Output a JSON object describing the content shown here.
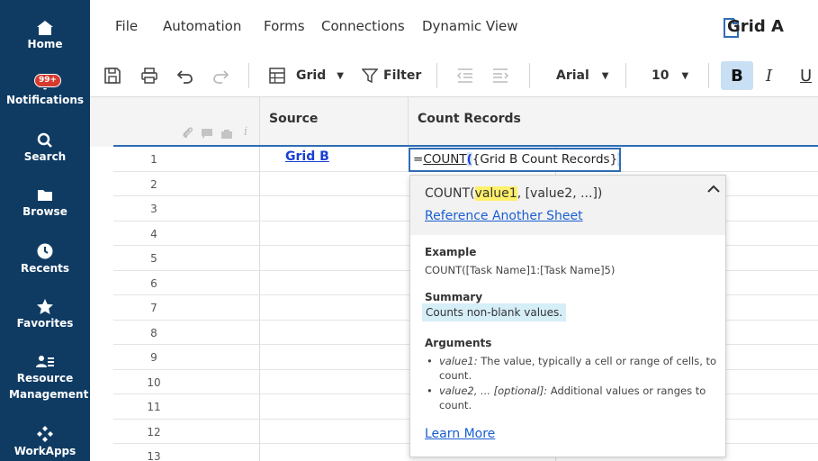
{
  "nav": {
    "items": [
      {
        "label": "Home",
        "icon": "home-icon"
      },
      {
        "label": "Notifications",
        "icon": "bell-icon",
        "badge": "99+"
      },
      {
        "label": "Search",
        "icon": "search-icon"
      },
      {
        "label": "Browse",
        "icon": "folder-icon"
      },
      {
        "label": "Recents",
        "icon": "clock-icon"
      },
      {
        "label": "Favorites",
        "icon": "star-icon"
      },
      {
        "label": "Resource Management",
        "icon": "people-icon"
      },
      {
        "label": "WorkApps",
        "icon": "apps-icon"
      }
    ]
  },
  "menu": {
    "items": [
      "File",
      "Automation",
      "Forms",
      "Connections",
      "Dynamic View"
    ],
    "title": "Grid A"
  },
  "toolbar": {
    "view_label": "Grid",
    "filter_label": "Filter",
    "font_family": "Arial",
    "font_size": "10",
    "bold": "B",
    "italic": "I",
    "underline": "U"
  },
  "grid": {
    "columns": [
      "Source",
      "Count Records"
    ],
    "row_numbers": [
      "1",
      "2",
      "3",
      "4",
      "5",
      "6",
      "7",
      "8",
      "9",
      "10",
      "11",
      "12",
      "13"
    ],
    "source_cell": "Grid B",
    "formula": {
      "prefix": "=",
      "fn": "COUNT",
      "paren": "(",
      "arg": "{Grid B Count Records}",
      "cursor": ")"
    }
  },
  "popup": {
    "sig_fn": "COUNT(",
    "sig_arg1": "value1",
    "sig_rest": ", [value2, ...])",
    "reference_link": "Reference Another Sheet",
    "example_title": "Example",
    "example_text": "COUNT([Task Name]1:[Task Name]5)",
    "summary_title": "Summary",
    "summary_text": "Counts non-blank values.",
    "arguments_title": "Arguments",
    "arg1_name": "value1:",
    "arg1_desc": " The value, typically a cell or range of cells, to count.",
    "arg2_name": "value2, ... [optional]:",
    "arg2_desc": " Additional values or ranges to count.",
    "learn_more": "Learn More"
  },
  "colors": {
    "nav_bg": "#0f3b63",
    "accent": "#2f6db5",
    "link": "#1a3fd1",
    "badge": "#d63b2f"
  }
}
